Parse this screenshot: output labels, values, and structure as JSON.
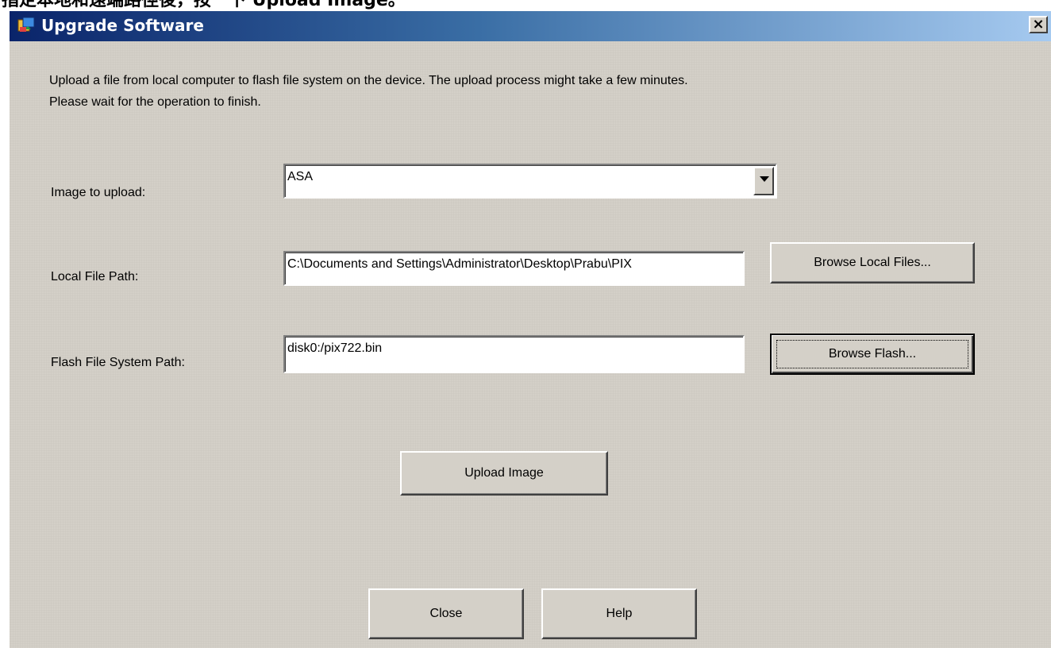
{
  "caption": {
    "text": "指定本地和遠端路徑後，按一下 Upload Image。"
  },
  "window": {
    "title": "Upgrade Software",
    "close_glyph": "×"
  },
  "description": {
    "line1": "Upload a file from local computer to flash file system on the device. The upload process might take a few minutes.",
    "line2": "Please wait for the operation to finish."
  },
  "image_to_upload": {
    "label": "Image to upload:",
    "value": "ASA"
  },
  "local_file_path": {
    "label": "Local File Path:",
    "value": "C:\\Documents and Settings\\Administrator\\Desktop\\Prabu\\PIX",
    "browse_label": "Browse Local Files..."
  },
  "flash_path": {
    "label": "Flash File System Path:",
    "value": "disk0:/pix722.bin",
    "browse_label": "Browse Flash..."
  },
  "buttons": {
    "upload": "Upload Image",
    "close": "Close",
    "help": "Help"
  },
  "colors": {
    "dialog_bg": "#d4d0c8",
    "title_start": "#0a246a",
    "title_end": "#a6caf0"
  },
  "icons": {
    "title": "upgrade-software-icon",
    "dropdown": "chevron-down-icon"
  }
}
